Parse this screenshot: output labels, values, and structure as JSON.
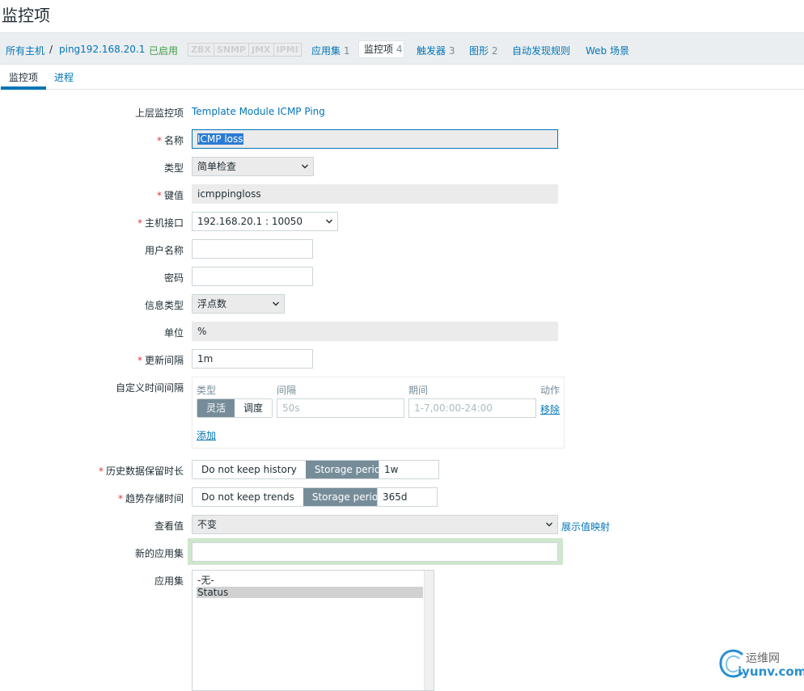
{
  "page": {
    "title": "监控项"
  },
  "nav": {
    "all_hosts": "所有主机",
    "separator": "/",
    "host": "ping192.168.20.1",
    "status": "已启用",
    "badges": [
      "ZBX",
      "SNMP",
      "JMX",
      "IPMI"
    ],
    "applications": {
      "label": "应用集",
      "count": "1"
    },
    "items": {
      "label": "监控项",
      "count": "4"
    },
    "triggers": {
      "label": "触发器",
      "count": "3"
    },
    "graphs": {
      "label": "图形",
      "count": "2"
    },
    "discovery": "自动发现规则",
    "web": "Web 场景"
  },
  "subtabs": [
    "监控项",
    "进程"
  ],
  "form": {
    "parent": {
      "label": "上层监控项",
      "value": "Template Module ICMP Ping"
    },
    "name": {
      "label": "名称",
      "value": "ICMP loss"
    },
    "type": {
      "label": "类型",
      "value": "简单检查"
    },
    "key": {
      "label": "键值",
      "value": "icmppingloss"
    },
    "interface": {
      "label": "主机接口",
      "value": "192.168.20.1 : 10050"
    },
    "username": {
      "label": "用户名称",
      "value": ""
    },
    "password": {
      "label": "密码",
      "value": ""
    },
    "info_type": {
      "label": "信息类型",
      "value": "浮点数"
    },
    "units": {
      "label": "单位",
      "value": "%"
    },
    "update_interval": {
      "label": "更新间隔",
      "value": "1m"
    },
    "custom_intervals": {
      "label": "自定义时间间隔",
      "headers": {
        "type": "类型",
        "interval": "间隔",
        "period": "期间",
        "action": "动作"
      },
      "row": {
        "flexible": "灵活",
        "scheduling": "调度",
        "interval_placeholder": "50s",
        "period_placeholder": "1-7,00:00-24:00",
        "remove": "移除"
      },
      "add": "添加"
    },
    "history": {
      "label": "历史数据保留时长",
      "off": "Do not keep history",
      "on": "Storage period",
      "value": "1w"
    },
    "trends": {
      "label": "趋势存储时间",
      "off": "Do not keep trends",
      "on": "Storage period",
      "value": "365d"
    },
    "valuemap": {
      "label": "查看值",
      "value": "不变",
      "link": "展示值映射"
    },
    "new_application": {
      "label": "新的应用集",
      "value": ""
    },
    "applications": {
      "label": "应用集",
      "options": [
        "-无-",
        "Status"
      ],
      "selected": "Status"
    }
  },
  "watermark": {
    "line1": "运维网",
    "line2": "iyunv.com"
  }
}
